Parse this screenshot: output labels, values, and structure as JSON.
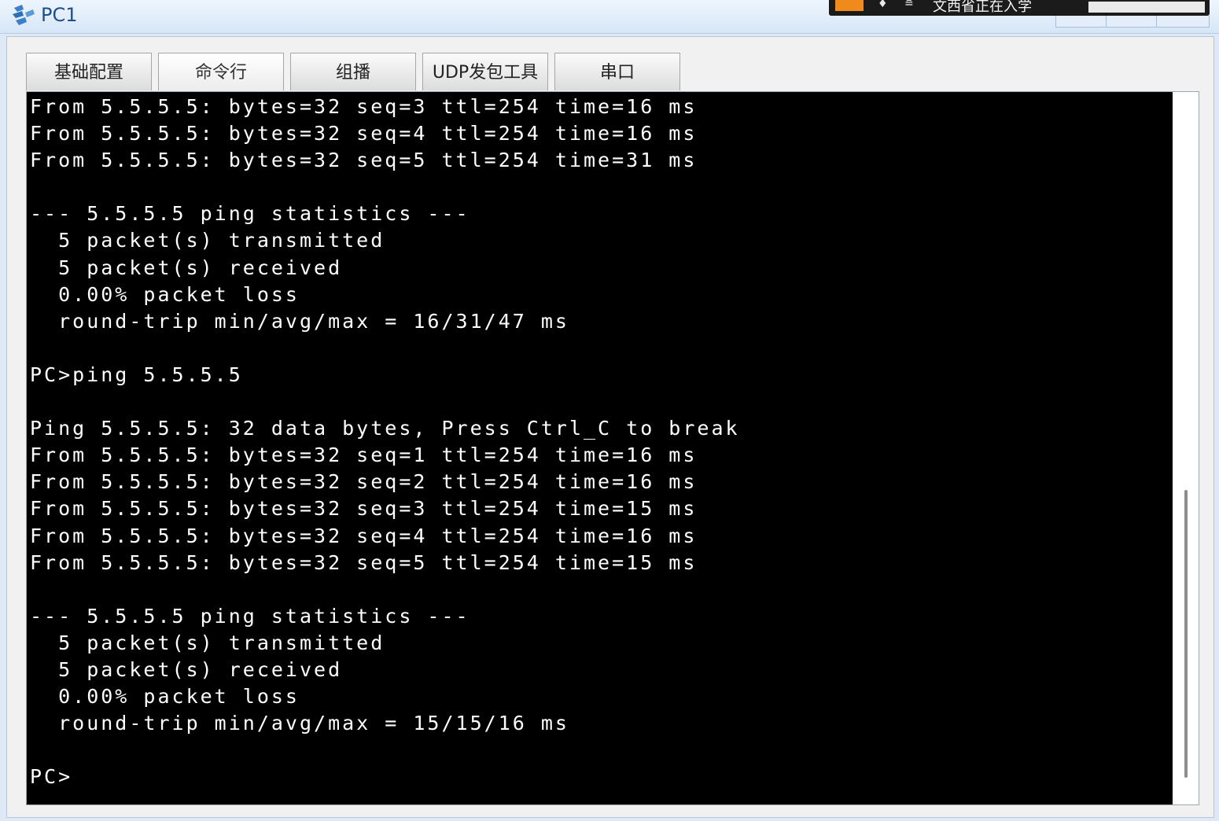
{
  "window": {
    "title": "PC1",
    "app_icon": "network-pc-icon"
  },
  "overlay": {
    "text": "文西省正在入学"
  },
  "tabs": [
    {
      "label": "基础配置",
      "active": false
    },
    {
      "label": "命令行",
      "active": true
    },
    {
      "label": "组播",
      "active": false
    },
    {
      "label": "UDP发包工具",
      "active": false
    },
    {
      "label": "串口",
      "active": false
    }
  ],
  "terminal": {
    "lines": [
      "From 5.5.5.5: bytes=32 seq=3 ttl=254 time=16 ms",
      "From 5.5.5.5: bytes=32 seq=4 ttl=254 time=16 ms",
      "From 5.5.5.5: bytes=32 seq=5 ttl=254 time=31 ms",
      "",
      "--- 5.5.5.5 ping statistics ---",
      "  5 packet(s) transmitted",
      "  5 packet(s) received",
      "  0.00% packet loss",
      "  round-trip min/avg/max = 16/31/47 ms",
      "",
      "PC>ping 5.5.5.5",
      "",
      "Ping 5.5.5.5: 32 data bytes, Press Ctrl_C to break",
      "From 5.5.5.5: bytes=32 seq=1 ttl=254 time=16 ms",
      "From 5.5.5.5: bytes=32 seq=2 ttl=254 time=16 ms",
      "From 5.5.5.5: bytes=32 seq=3 ttl=254 time=15 ms",
      "From 5.5.5.5: bytes=32 seq=4 ttl=254 time=16 ms",
      "From 5.5.5.5: bytes=32 seq=5 ttl=254 time=15 ms",
      "",
      "--- 5.5.5.5 ping statistics ---",
      "  5 packet(s) transmitted",
      "  5 packet(s) received",
      "  0.00% packet loss",
      "  round-trip min/avg/max = 15/15/16 ms",
      "",
      "PC>"
    ]
  },
  "colors": {
    "terminal_bg": "#000000",
    "terminal_fg": "#ffffff",
    "title_color": "#1f4e8f",
    "overlay_accent": "#f08a1c"
  }
}
